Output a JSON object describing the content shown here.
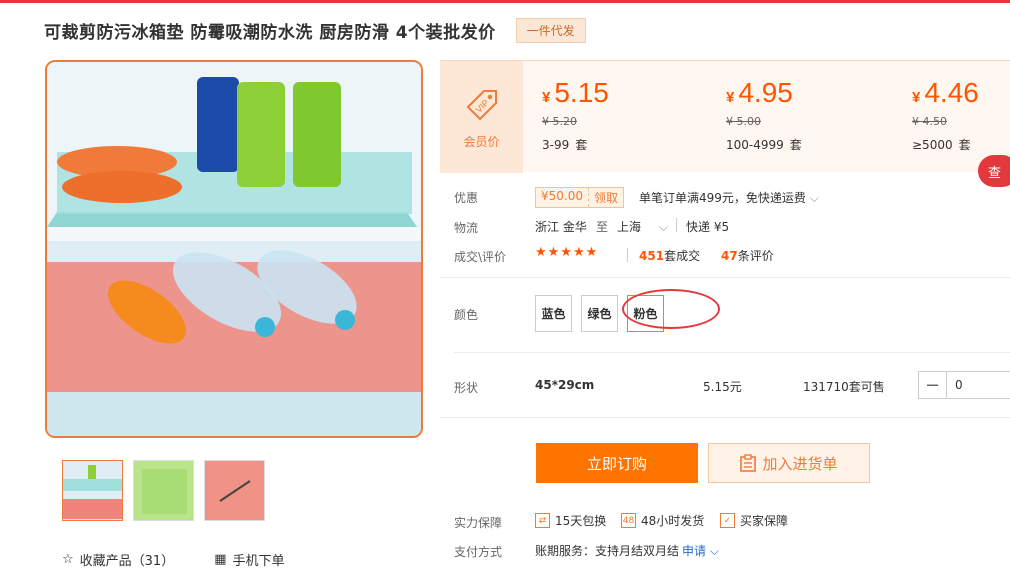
{
  "product": {
    "title": "可裁剪防污冰箱垫 防霉吸潮防水洗 厨房防滑 4个装批发价",
    "tag": "一件代发"
  },
  "vip": {
    "label": "会员价"
  },
  "price_tiers": [
    {
      "currency": "¥",
      "price": "5.15",
      "old": "¥ 5.20",
      "qty": "3-99",
      "unit": "套"
    },
    {
      "currency": "¥",
      "price": "4.95",
      "old": "¥ 5.00",
      "qty": "100-4999",
      "unit": "套"
    },
    {
      "currency": "¥",
      "price": "4.46",
      "old": "¥ 4.50",
      "qty": "≥5000",
      "unit": "套"
    }
  ],
  "side_tab": "查",
  "offers": {
    "label": "优惠",
    "coupon_amount": "¥50.00",
    "coupon_action": "领取",
    "text": "单笔订单满499元，免快递运费"
  },
  "logistics": {
    "label": "物流",
    "from": "浙江 金华",
    "to_word": "至",
    "to": "上海",
    "express": "快递 ¥5"
  },
  "reviews": {
    "label": "成交\\评价",
    "stars": "★★★★★",
    "deals_count": "451",
    "deals_text": "套成交",
    "reviews_count": "47",
    "reviews_text": "条评价"
  },
  "colors": {
    "label": "颜色",
    "options": [
      "蓝色",
      "绿色",
      "粉色"
    ],
    "selected": "粉色"
  },
  "shape": {
    "label": "形状",
    "name": "45*29cm",
    "price": "5.15元",
    "stock": "131710套可售",
    "quantity": "0"
  },
  "actions": {
    "buy": "立即订购",
    "cart": "加入进货单"
  },
  "guarantees": {
    "label": "实力保障",
    "items": [
      {
        "icon": "exchange-icon",
        "text": "15天包换"
      },
      {
        "icon": "clock-48-icon",
        "text": "48小时发货"
      },
      {
        "icon": "shield-icon",
        "text": "买家保障"
      }
    ]
  },
  "payment": {
    "label": "支付方式",
    "text": "账期服务：支持月结双月结",
    "link": "申请"
  },
  "bottom": {
    "favorite": "收藏产品（31）",
    "mobile": "手机下单"
  },
  "colors_theme": {
    "accent": "#ff7300",
    "price": "#ff5500",
    "brand_red": "#e4393c"
  }
}
